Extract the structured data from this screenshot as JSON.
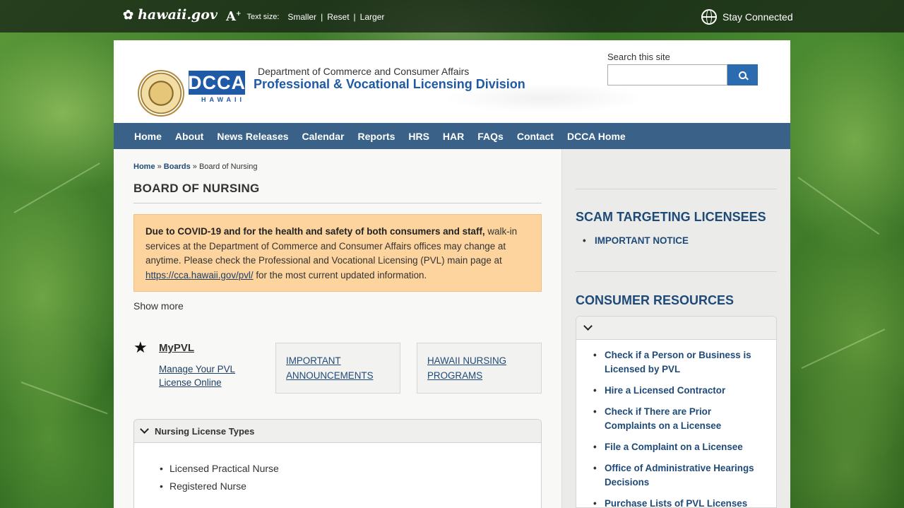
{
  "topbar": {
    "logo_text": "hawaii.gov",
    "text_size_label": "Text size:",
    "smaller": "Smaller",
    "reset": "Reset",
    "larger": "Larger",
    "stay_connected": "Stay Connected"
  },
  "header": {
    "dcca_logo": "DCCA",
    "dcca_sub": "HAWAII",
    "department": "Department of Commerce and Consumer Affairs",
    "division": "Professional & Vocational Licensing Division",
    "search_label": "Search this site",
    "search_placeholder": ""
  },
  "nav": [
    "Home",
    "About",
    "News Releases",
    "Calendar",
    "Reports",
    "HRS",
    "HAR",
    "FAQs",
    "Contact",
    "DCCA Home"
  ],
  "breadcrumb": {
    "home": "Home",
    "sep1": " » ",
    "boards": "Boards",
    "sep2": " » ",
    "current": "Board of Nursing"
  },
  "page_title": "BOARD OF NURSING",
  "notice": {
    "bold": "Due to COVID-19 and for the health and safety of both consumers and staff,",
    "text1": " walk-in services at the Department of Commerce and Consumer Affairs offices may change at anytime.  Please check the Professional and Vocational Licensing (PVL) main page at ",
    "link": "https://cca.hawaii.gov/pvl/",
    "text2": " for the most current updated information."
  },
  "show_more": "Show more",
  "mypvl": {
    "title": "MyPVL",
    "link": "Manage Your PVL License Online"
  },
  "cards": [
    "IMPORTANT ANNOUNCEMENTS",
    "HAWAII NURSING PROGRAMS"
  ],
  "accordion": {
    "title": "Nursing License Types",
    "items": [
      "Licensed Practical Nurse",
      "Registered Nurse"
    ]
  },
  "sidebar": {
    "scam_title": "SCAM TARGETING LICENSEES",
    "scam_items": [
      "IMPORTANT NOTICE"
    ],
    "consumer_title": "CONSUMER RESOURCES",
    "consumer_items": [
      "Check if a Person or Business is Licensed by PVL",
      "Hire a Licensed Contractor",
      "Check if There are Prior Complaints on a Licensee",
      "File a Complaint on a Licensee",
      "Office of Administrative Hearings Decisions",
      "Purchase Lists of PVL Licenses"
    ]
  },
  "colors": {
    "nav": "#3a6188",
    "link": "#1f4a78",
    "notice": "#fdd49e",
    "dcca_blue": "#1f5aa6"
  }
}
